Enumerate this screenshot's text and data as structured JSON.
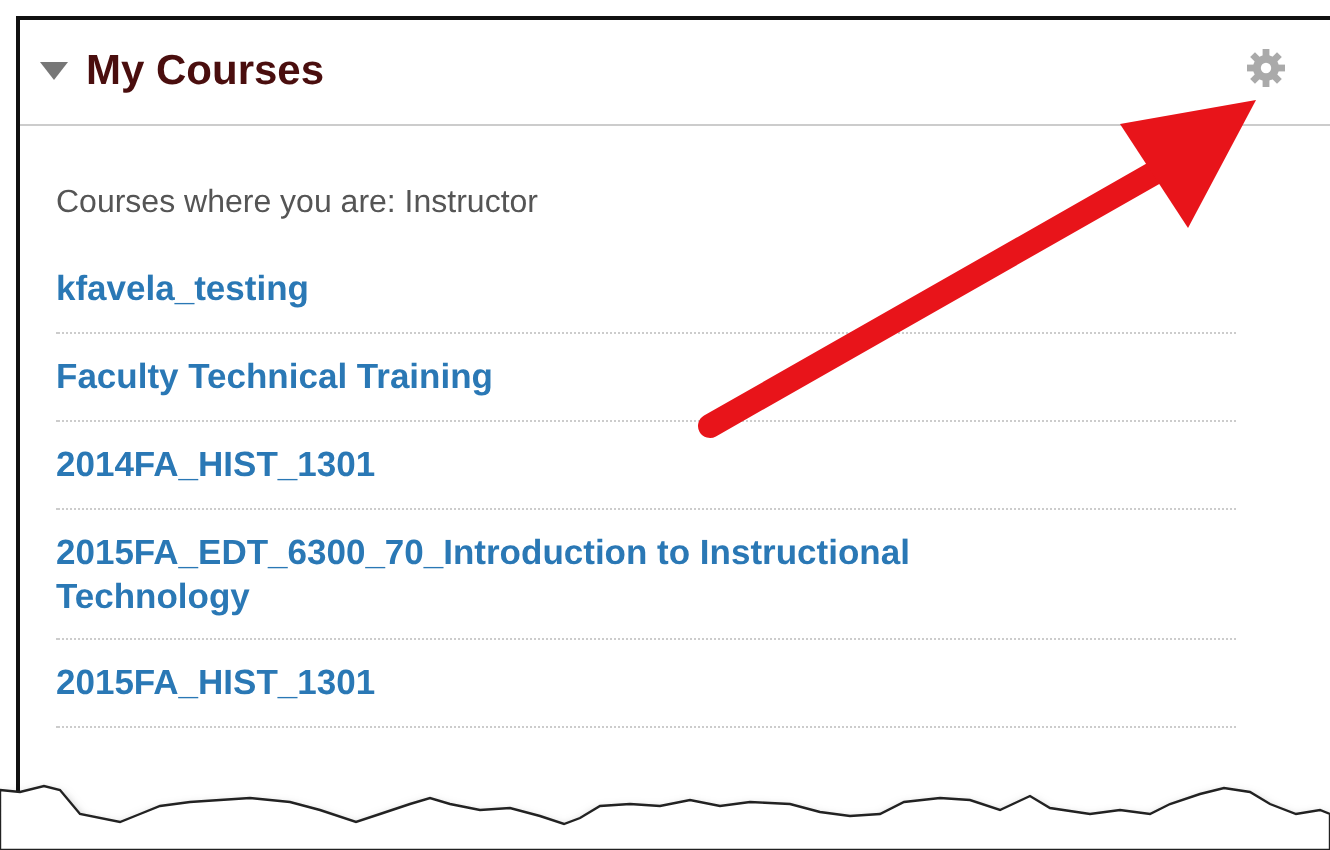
{
  "panel": {
    "title": "My Courses",
    "expanded": true
  },
  "role_label": "Courses where you are: Instructor",
  "courses": [
    {
      "name": "kfavela_testing"
    },
    {
      "name": "Faculty Technical Training"
    },
    {
      "name": "2014FA_HIST_1301"
    },
    {
      "name": "2015FA_EDT_6300_70_Introduction to Instructional Technology"
    },
    {
      "name": "2015FA_HIST_1301"
    }
  ]
}
